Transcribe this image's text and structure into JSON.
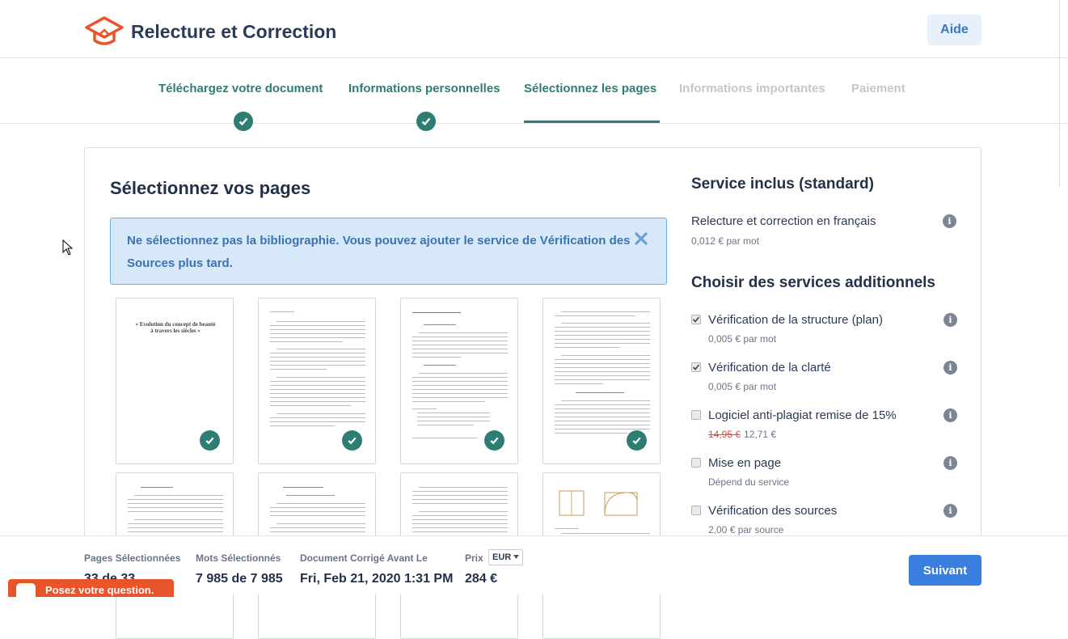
{
  "header": {
    "app_title": "Relecture et Correction",
    "help_label": "Aide",
    "logo_icon": "graduation-cap-logo",
    "brand_color": "#e8552a"
  },
  "steps": [
    {
      "label": "Téléchargez votre document",
      "state": "done"
    },
    {
      "label": "Informations personnelles",
      "state": "done"
    },
    {
      "label": "Sélectionnez les pages",
      "state": "active"
    },
    {
      "label": "Informations importantes",
      "state": "pending"
    },
    {
      "label": "Paiement",
      "state": "pending"
    }
  ],
  "main": {
    "title": "Sélectionnez vos pages",
    "alert_text": "Ne sélectionnez pas la bibliographie. Vous pouvez ajouter le service de Vérification des Sources plus tard.",
    "pages_selected_icon": "check-circle-icon"
  },
  "sidebar": {
    "included_heading": "Service inclus (standard)",
    "included_service": {
      "name": "Relecture et correction en français",
      "price": "0,012 € par mot"
    },
    "additional_heading": "Choisir des services additionnels",
    "options": [
      {
        "name": "Vérification de la structure (plan)",
        "price": "0,005 € par mot",
        "checked": true
      },
      {
        "name": "Vérification de la clarté",
        "price": "0,005 € par mot",
        "checked": true
      },
      {
        "name": "Logiciel anti-plagiat remise de 15%",
        "old_price": "14,95 €",
        "price": "12,71 €",
        "checked": false
      },
      {
        "name": "Mise en page",
        "price": "Dépend du service",
        "checked": false
      },
      {
        "name": "Vérification des sources",
        "price": "2,00 € par source",
        "checked": false
      }
    ]
  },
  "footer": {
    "pages_label": "Pages Sélectionnées",
    "pages_value": "33 de 33",
    "words_label": "Mots Sélectionnés",
    "words_value": "7 985 de 7 985",
    "date_label": "Document Corrigé Avant Le",
    "date_value": "Fri, Feb 21, 2020 1:31 PM",
    "price_label": "Prix",
    "currency": "EUR",
    "price_value": "284 €",
    "next_label": "Suivant",
    "chat_label": "Posez votre question."
  },
  "colors": {
    "step_done": "#2e7d73",
    "accent_blue": "#3a7ee0",
    "alert_bg": "#d7e9f8"
  }
}
